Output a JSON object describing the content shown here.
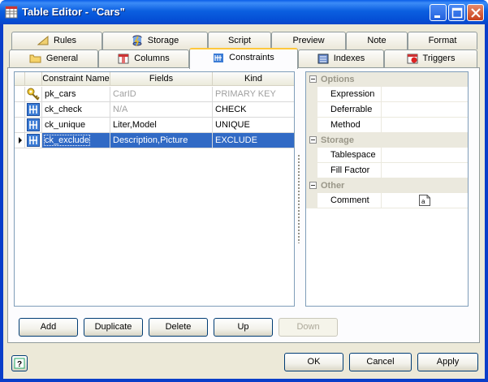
{
  "window": {
    "title": "Table Editor - \"Cars\""
  },
  "tabs_row1": [
    {
      "label": "Rules",
      "icon": "rules-icon"
    },
    {
      "label": "Storage",
      "icon": "storage-icon"
    },
    {
      "label": "Script",
      "icon": ""
    },
    {
      "label": "Preview",
      "icon": ""
    },
    {
      "label": "Note",
      "icon": ""
    },
    {
      "label": "Format",
      "icon": ""
    }
  ],
  "tabs_row2": [
    {
      "label": "General",
      "icon": "folder-icon"
    },
    {
      "label": "Columns",
      "icon": "columns-icon"
    },
    {
      "label": "Constraints",
      "icon": "constraints-icon",
      "active": true
    },
    {
      "label": "Indexes",
      "icon": "indexes-icon"
    },
    {
      "label": "Triggers",
      "icon": "triggers-icon"
    }
  ],
  "grid": {
    "headers": [
      "Constraint Name",
      "Fields",
      "Kind"
    ],
    "rows": [
      {
        "icon": "key-icon",
        "name": "pk_cars",
        "fields": "CarID",
        "kind": "PRIMARY KEY",
        "greyed": true
      },
      {
        "icon": "constraint-icon",
        "name": "ck_check",
        "fields": "N/A",
        "kind": "CHECK",
        "greyed_fields": true
      },
      {
        "icon": "constraint-icon",
        "name": "ck_unique",
        "fields": "Liter,Model",
        "kind": "UNIQUE"
      },
      {
        "icon": "constraint-icon",
        "name": "ck_exclude",
        "fields": "Description,Picture",
        "kind": "EXCLUDE",
        "selected": true
      }
    ]
  },
  "properties": {
    "categories": [
      {
        "label": "Options",
        "items": [
          "Expression",
          "Deferrable",
          "Method"
        ]
      },
      {
        "label": "Storage",
        "items": [
          "Tablespace",
          "Fill Factor"
        ]
      },
      {
        "label": "Other",
        "items": [
          "Comment"
        ]
      }
    ]
  },
  "buttons": {
    "add": "Add",
    "duplicate": "Duplicate",
    "delete": "Delete",
    "up": "Up",
    "down": "Down",
    "ok": "OK",
    "cancel": "Cancel",
    "apply": "Apply"
  },
  "colors": {
    "selection": "#316ac5",
    "titlebar": "#0550d6",
    "active_tab": "#ffc83c"
  }
}
